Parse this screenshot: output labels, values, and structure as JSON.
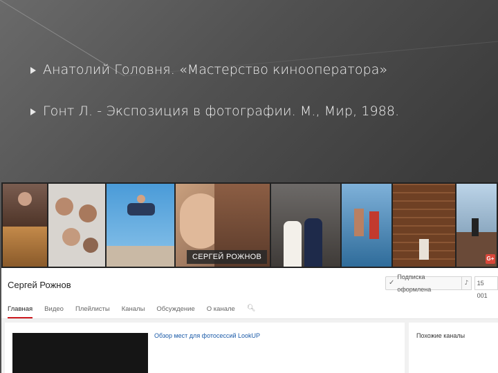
{
  "slide": {
    "line1": "Анатолий Головня. «Мастерство кинооператора»",
    "line2": "Гонт Л. - Экспозиция в фотографии. М., Мир, 1988."
  },
  "banner": {
    "name_tag": "СЕРГЕЙ РОЖНОВ",
    "gplus_label": "G+"
  },
  "channel": {
    "title": "Сергей Рожнов",
    "subscribe_label": "Подписка оформлена",
    "subscriber_count": "15 001",
    "tabs": [
      "Главная",
      "Видео",
      "Плейлисты",
      "Каналы",
      "Обсуждение",
      "О канале"
    ],
    "active_tab": "Главная"
  },
  "content": {
    "video_title": "Обзор мест для фотосессий LookUP",
    "side_title": "Похожие каналы"
  },
  "colors": {
    "accent_red": "#cc181e",
    "link_blue": "#1a5aa8",
    "slide_bg": "#4a4a4a"
  }
}
